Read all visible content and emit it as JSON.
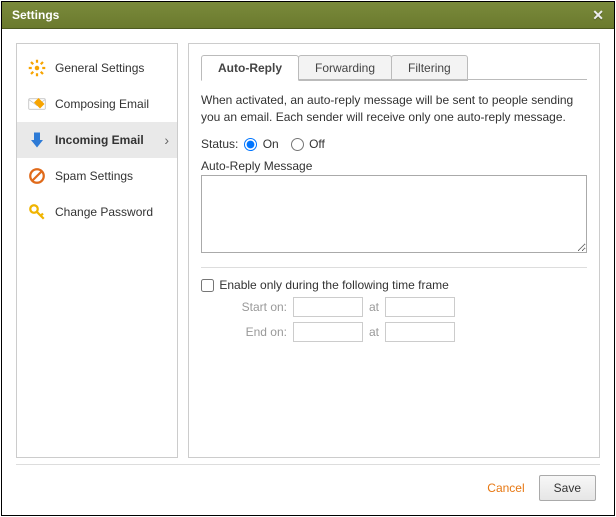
{
  "window": {
    "title": "Settings"
  },
  "sidebar": {
    "items": [
      {
        "label": "General Settings"
      },
      {
        "label": "Composing Email"
      },
      {
        "label": "Incoming Email"
      },
      {
        "label": "Spam Settings"
      },
      {
        "label": "Change Password"
      }
    ]
  },
  "tabs": {
    "auto_reply": "Auto-Reply",
    "forwarding": "Forwarding",
    "filtering": "Filtering"
  },
  "main": {
    "description": "When activated, an auto-reply message will be sent to people sending you an email. Each sender will receive only one auto-reply message.",
    "status_label": "Status:",
    "status_on": "On",
    "status_off": "Off",
    "status_value": "on",
    "message_label": "Auto-Reply Message",
    "message_value": "",
    "timeframe_label": "Enable only during the following time frame",
    "timeframe_checked": false,
    "start_label": "Start on:",
    "end_label": "End on:",
    "at_label": "at",
    "start_date": "",
    "start_time": "",
    "end_date": "",
    "end_time": ""
  },
  "footer": {
    "cancel": "Cancel",
    "save": "Save"
  }
}
